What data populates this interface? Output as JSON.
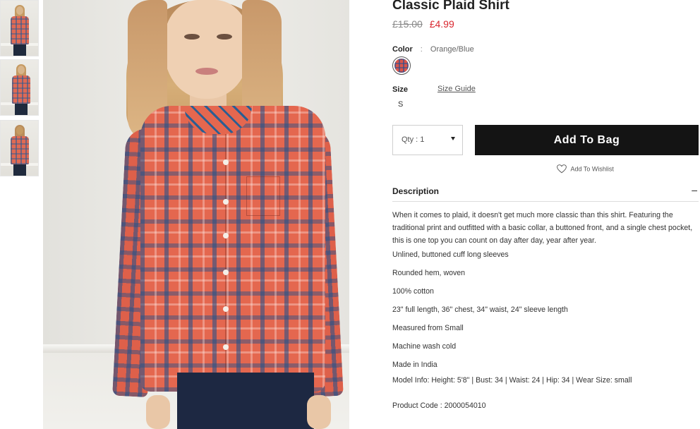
{
  "thumbnails": [
    {
      "alt": "thumbnail-1"
    },
    {
      "alt": "thumbnail-2"
    },
    {
      "alt": "thumbnail-3"
    }
  ],
  "product": {
    "title": "Classic Plaid Shirt",
    "price_original": "£15.00",
    "price_sale": "£4.99",
    "color_label": "Color",
    "color_separator": ":",
    "color_value": "Orange/Blue",
    "size_label": "Size",
    "size_guide": "Size Guide",
    "size_option": "S",
    "qty_label": "Qty : 1",
    "add_to_bag": "Add To Bag",
    "wishlist": "Add To Wishlist"
  },
  "description": {
    "heading": "Description",
    "collapse_symbol": "–",
    "paragraph": "When it comes to plaid, it doesn't get much more classic than this shirt. Featuring the traditional print and outfitted with a basic collar, a buttoned front, and a single chest pocket, this is one top you can count on day after day, year after year.",
    "features": [
      "Unlined, buttoned cuff long sleeves",
      "Rounded hem, woven",
      "100% cotton",
      "23\" full length, 36\" chest, 34\" waist, 24\" sleeve length",
      "Measured from Small",
      "Machine wash cold",
      "Made in India",
      "Model Info: Height: 5'8\" | Bust: 34 | Waist: 24 | Hip: 34 | Wear Size: small"
    ],
    "product_code": "Product Code : 2000054010"
  },
  "colors": {
    "sale_price": "#d9262e",
    "button_bg": "#141414",
    "button_text": "#ffffff"
  },
  "icons": {
    "wishlist": "heart-icon",
    "qty_dropdown": "caret-down-icon"
  }
}
